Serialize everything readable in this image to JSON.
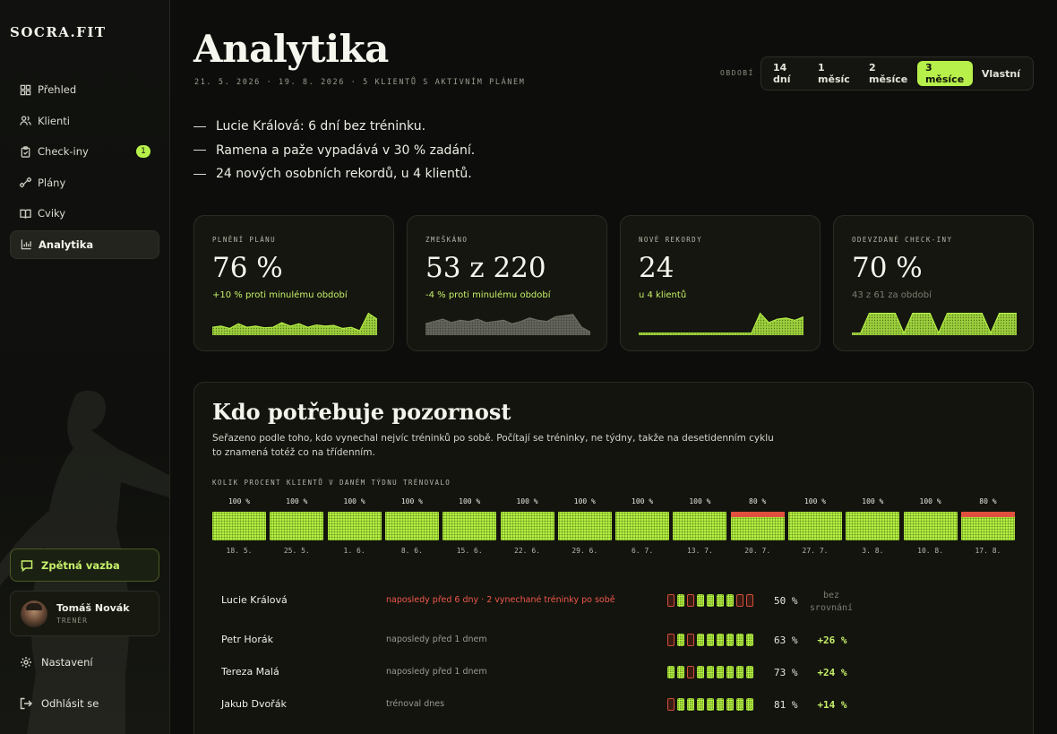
{
  "app": {
    "logo": "SOCRA.FIT"
  },
  "sidebar": {
    "items": [
      {
        "label": "Přehled",
        "icon": "grid-icon"
      },
      {
        "label": "Klienti",
        "icon": "users-icon"
      },
      {
        "label": "Check-iny",
        "icon": "clipboard-icon",
        "badge": "1"
      },
      {
        "label": "Plány",
        "icon": "dumbbell-icon"
      },
      {
        "label": "Cviky",
        "icon": "book-icon"
      },
      {
        "label": "Analytika",
        "icon": "bar-chart-icon",
        "active": true
      }
    ],
    "feedback": "Zpětná vazba",
    "user": {
      "name": "Tomáš Novák",
      "role": "TRENÉR"
    },
    "settings": "Nastavení",
    "logout": "Odhlásit se"
  },
  "header": {
    "title": "Analytika",
    "subtitle": "21. 5. 2026 · 19. 8. 2026 · 5 KLIENTŮ S AKTIVNÍM PLÁNEM",
    "period_label": "OBDOBÍ",
    "periods": [
      "14 dní",
      "1 měsíc",
      "2 měsíce",
      "3 měsíce",
      "Vlastní"
    ],
    "active_period": "3 měsíce"
  },
  "insights": [
    "Lucie Králová: 6 dní bez tréninku.",
    "Ramena a paže vypadává v 30 % zadání.",
    "24 nových osobních rekordů, u 4 klientů."
  ],
  "kpis": [
    {
      "label": "PLNĚNÍ PLÁNU",
      "value": "76 %",
      "delta": "+10 % proti minulému období",
      "delta_muted": false,
      "spark": [
        0.3,
        0.35,
        0.25,
        0.45,
        0.3,
        0.35,
        0.28,
        0.3,
        0.5,
        0.35,
        0.45,
        0.3,
        0.4,
        0.35,
        0.38,
        0.25,
        0.3,
        0.15,
        0.9,
        0.65
      ]
    },
    {
      "label": "ZMEŠKÁNO",
      "value": "53 z 220",
      "delta": "-4 % proti minulému období",
      "delta_muted": false,
      "spark": [
        0.45,
        0.55,
        0.65,
        0.5,
        0.6,
        0.55,
        0.65,
        0.5,
        0.55,
        0.6,
        0.45,
        0.55,
        0.7,
        0.6,
        0.55,
        0.75,
        0.8,
        0.85,
        0.3,
        0.1
      ]
    },
    {
      "label": "NOVÉ REKORDY",
      "value": "24",
      "delta": "u 4 klientů",
      "delta_muted": false,
      "spark": [
        0.05,
        0.05,
        0.05,
        0.05,
        0.05,
        0.05,
        0.05,
        0.05,
        0.05,
        0.05,
        0.05,
        0.05,
        0.05,
        0.05,
        0.9,
        0.5,
        0.65,
        0.7,
        0.6,
        0.75
      ]
    },
    {
      "label": "ODEVZDANÉ CHECK-INY",
      "value": "70 %",
      "delta": "43 z 61 za období",
      "delta_muted": true,
      "spark": [
        0.05,
        0.05,
        0.9,
        0.9,
        0.9,
        0.9,
        0.05,
        0.9,
        0.9,
        0.9,
        0.05,
        0.9,
        0.9,
        0.9,
        0.9,
        0.9,
        0.05,
        0.9,
        0.9,
        0.9
      ]
    }
  ],
  "attention": {
    "title": "Kdo potřebuje pozornost",
    "description": "Seřazeno podle toho, kdo vynechal nejvíc tréninků po sobě. Počítají se tréninky, ne týdny, takže na desetidenním cyklu to znamená totéž co na třídenním.",
    "week_caption": "KOLIK PROCENT KLIENTŮ V DANÉM TÝDNU TRÉNOVALO",
    "chart_data": {
      "type": "bar",
      "categories": [
        "18. 5.",
        "25. 5.",
        "1. 6.",
        "8. 6.",
        "15. 6.",
        "22. 6.",
        "29. 6.",
        "6. 7.",
        "13. 7.",
        "20. 7.",
        "27. 7.",
        "3. 8.",
        "10. 8.",
        "17. 8."
      ],
      "values": [
        100,
        100,
        100,
        100,
        100,
        100,
        100,
        100,
        100,
        80,
        100,
        100,
        100,
        80
      ],
      "value_labels": [
        "100 %",
        "100 %",
        "100 %",
        "100 %",
        "100 %",
        "100 %",
        "100 %",
        "100 %",
        "100 %",
        "80 %",
        "100 %",
        "100 %",
        "100 %",
        "80 %"
      ],
      "ylim": [
        0,
        100
      ]
    },
    "rows": [
      {
        "name": "Lucie Králová",
        "status": "naposledy před 6 dny · 2 vynechané tréninky po sobě",
        "alert": true,
        "cells": [
          0,
          1,
          0,
          1,
          1,
          1,
          1,
          0,
          0
        ],
        "pct": "50 %",
        "cmp": "bez srovnání",
        "cmp_muted": true
      },
      {
        "name": "Petr Horák",
        "status": "naposledy před 1 dnem",
        "alert": false,
        "cells": [
          0,
          1,
          0,
          1,
          1,
          1,
          1,
          1,
          1
        ],
        "pct": "63 %",
        "cmp": "+26 %",
        "cmp_muted": false
      },
      {
        "name": "Tereza Malá",
        "status": "naposledy před 1 dnem",
        "alert": false,
        "cells": [
          1,
          1,
          0,
          1,
          1,
          1,
          1,
          1,
          1
        ],
        "pct": "73 %",
        "cmp": "+24 %",
        "cmp_muted": false
      },
      {
        "name": "Jakub Dvořák",
        "status": "trénoval dnes",
        "alert": false,
        "cells": [
          0,
          1,
          1,
          1,
          1,
          1,
          1,
          1,
          1
        ],
        "pct": "81 %",
        "cmp": "+14 %",
        "cmp_muted": false
      }
    ]
  }
}
